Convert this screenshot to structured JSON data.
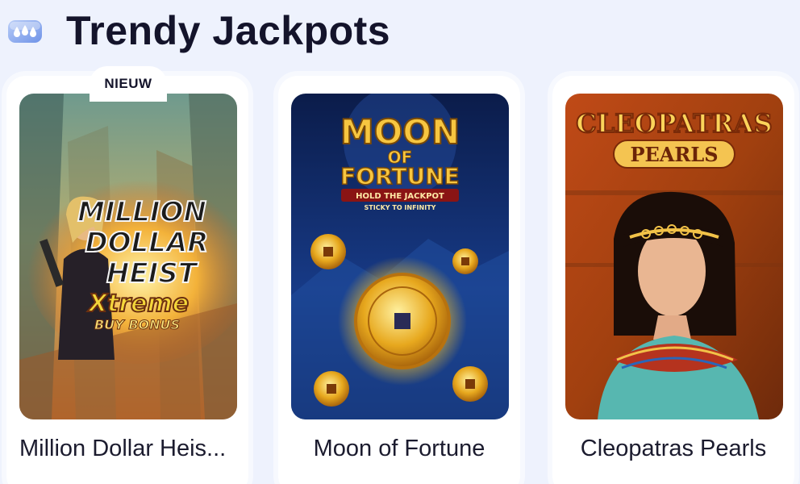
{
  "section": {
    "title": "Trendy Jackpots",
    "icon": "water-drops-icon"
  },
  "games": [
    {
      "name": "Million Dollar Heis...",
      "badge": "NIEUW",
      "art": {
        "line1": "MILLION",
        "line2": "DOLLAR",
        "line3": "HEIST",
        "line4": "Xtreme",
        "line5": "BUY BONUS"
      }
    },
    {
      "name": "Moon of Fortune",
      "art": {
        "line1": "MOON",
        "line2": "OF",
        "line3": "FORTUNE",
        "line4": "HOLD THE JACKPOT",
        "line5": "STICKY TO INFINITY"
      }
    },
    {
      "name": "Cleopatras Pearls",
      "art": {
        "line1": "CLEOPATRAS",
        "line2": "PEARLS"
      }
    }
  ],
  "colors": {
    "background": "#eef2fd",
    "card": "#ffffff",
    "title": "#14142b"
  }
}
